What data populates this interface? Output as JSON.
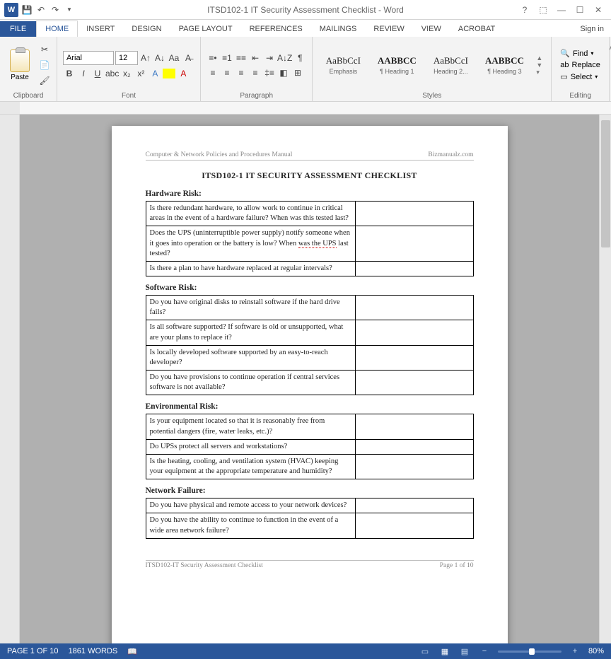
{
  "titlebar": {
    "title": "ITSD102-1 IT Security Assessment Checklist - Word"
  },
  "qat": {
    "word": "W"
  },
  "tabs": {
    "file": "FILE",
    "home": "HOME",
    "insert": "INSERT",
    "design": "DESIGN",
    "page_layout": "PAGE LAYOUT",
    "references": "REFERENCES",
    "mailings": "MAILINGS",
    "review": "REVIEW",
    "view": "VIEW",
    "acrobat": "ACROBAT",
    "signin": "Sign in"
  },
  "ribbon": {
    "clipboard": {
      "paste": "Paste",
      "label": "Clipboard"
    },
    "font": {
      "name": "Arial",
      "size": "12",
      "label": "Font"
    },
    "paragraph": {
      "label": "Paragraph"
    },
    "styles": {
      "label": "Styles",
      "items": [
        {
          "preview": "AaBbCcI",
          "name": "Emphasis"
        },
        {
          "preview": "AABBCC",
          "name": "¶ Heading 1"
        },
        {
          "preview": "AaBbCcI",
          "name": "Heading 2..."
        },
        {
          "preview": "AABBCC",
          "name": "¶ Heading 3"
        }
      ]
    },
    "editing": {
      "find": "Find",
      "replace": "Replace",
      "select": "Select",
      "label": "Editing"
    }
  },
  "doc": {
    "header_left": "Computer & Network Policies and Procedures Manual",
    "header_right": "Bizmanualz.com",
    "title": "ITSD102-1   IT SECURITY ASSESSMENT CHECKLIST",
    "sections": [
      {
        "heading": "Hardware Risk:",
        "rows": [
          "Is there redundant hardware, to allow work to continue in critical areas in the event of a hardware failure?  When was this tested last?",
          "Does the UPS (uninterruptible power supply) notify someone when it goes into operation or the battery is low? When |was the UPS| last tested?",
          "Is there a plan to have hardware replaced at regular intervals?"
        ]
      },
      {
        "heading": "Software Risk:",
        "rows": [
          "Do you have original disks to reinstall software if the hard drive fails?",
          "Is all software supported?  If software is old or unsupported, what are your plans to replace it?",
          "Is locally developed software supported by an easy-to-reach developer?",
          "Do you have provisions to continue operation if central services software is not available?"
        ]
      },
      {
        "heading": "Environmental Risk:",
        "rows": [
          "Is your equipment located so that it is reasonably free from potential dangers (fire, water leaks, etc.)?",
          "Do UPSs protect all servers and workstations?",
          "Is the heating, cooling, and ventilation system (HVAC) keeping your equipment at the appropriate temperature and humidity?"
        ]
      },
      {
        "heading": "Network Failure:",
        "rows": [
          "Do you have physical and remote access to your network devices?",
          "Do you have the ability to continue to function in the event of a wide area network failure?"
        ]
      }
    ],
    "footer_left": "ITSD102-IT Security Assessment Checklist",
    "footer_right": "Page 1 of 10"
  },
  "status": {
    "page": "PAGE 1 OF 10",
    "words": "1861 WORDS",
    "zoom": "80%"
  }
}
